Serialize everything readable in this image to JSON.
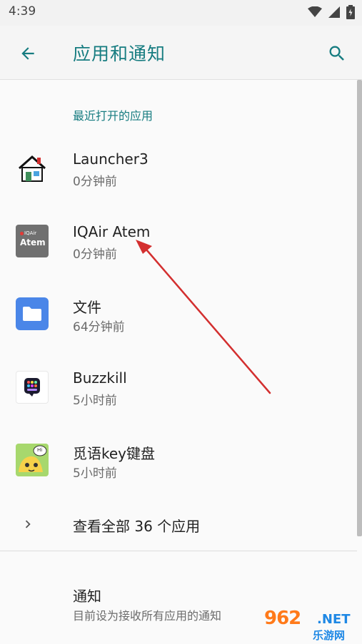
{
  "status_bar": {
    "time": "4:39"
  },
  "header": {
    "title": "应用和通知"
  },
  "recent": {
    "section_title": "最近打开的应用",
    "apps": [
      {
        "name": "Launcher3",
        "time": "0分钟前",
        "icon": "house-icon"
      },
      {
        "name": "IQAir Atem",
        "time": "0分钟前",
        "icon": "iqair-atem-icon",
        "icon_text": "Atem",
        "icon_small": "IQAir"
      },
      {
        "name": "文件",
        "time": "64分钟前",
        "icon": "folder-icon"
      },
      {
        "name": "Buzzkill",
        "time": "5小时前",
        "icon": "buzzkill-icon"
      },
      {
        "name": "觅语key键盘",
        "time": "5小时前",
        "icon": "keyboard-mascot-icon",
        "icon_bubble": "Hi"
      }
    ]
  },
  "see_all": {
    "label": "查看全部 36 个应用"
  },
  "notifications": {
    "title": "通知",
    "subtitle": "目前设为接收所有应用的通知"
  },
  "watermark": {
    "big": "962",
    "net": ".NET",
    "small": "乐游网"
  },
  "colors": {
    "accent": "#167c80",
    "annotation_arrow": "#d32f2f"
  }
}
